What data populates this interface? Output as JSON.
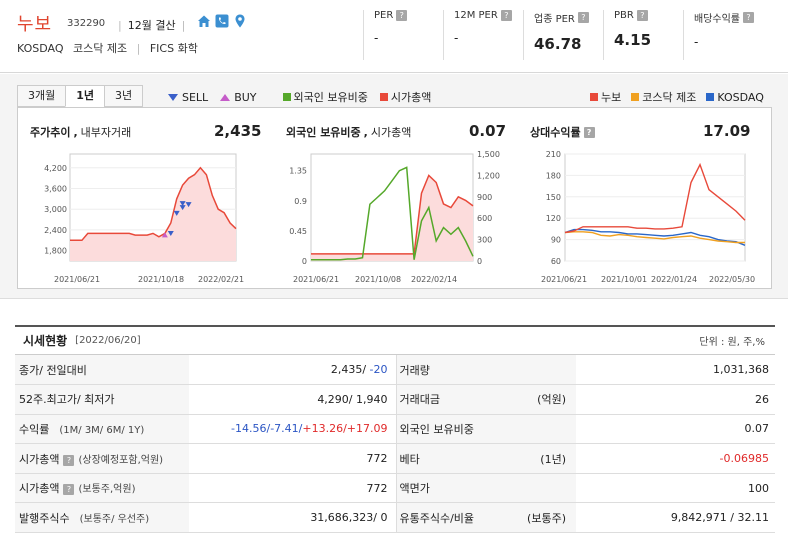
{
  "header": {
    "name": "누보",
    "code": "332290",
    "fiscal": "12월 결산",
    "market": "KOSDAQ",
    "sector1": "코스닥 제조",
    "sector2": "FICS 화학",
    "metrics": [
      {
        "label": "PER",
        "value": "-"
      },
      {
        "label": "12M PER",
        "value": "-"
      },
      {
        "label": "업종 PER",
        "value": "46.78"
      },
      {
        "label": "PBR",
        "value": "4.15"
      },
      {
        "label": "배당수익률",
        "value": "-"
      }
    ]
  },
  "tabs": [
    "3개월",
    "1년",
    "3년"
  ],
  "legend_left": {
    "sell": "SELL",
    "buy": "BUY",
    "foreign": "외국인 보유비중",
    "cap": "시가총액"
  },
  "legend_right": {
    "a": "누보",
    "b": "코스닥 제조",
    "c": "KOSDAQ"
  },
  "colors": {
    "red": "#e8493a",
    "green": "#55a82a",
    "orange": "#f0a020",
    "blue": "#2a67c9",
    "pink": "#fcdcdc"
  },
  "chart_data": [
    {
      "type": "area",
      "title": "주가추이",
      "subtitle": "내부자거래",
      "value": "2,435",
      "x_ticks": [
        "2021/06/21",
        "2021/10/18",
        "2022/02/21"
      ],
      "y_ticks": [
        "4,200",
        "3,600",
        "3,000",
        "2,400",
        "1,800"
      ],
      "ylim": [
        1500,
        4600
      ],
      "series": [
        {
          "values": [
            2100,
            2100,
            2100,
            2300,
            2300,
            2300,
            2300,
            2300,
            2300,
            2300,
            2300,
            2250,
            2250,
            2250,
            2300,
            2200,
            2300,
            2600,
            3300,
            3700,
            3900,
            4000,
            4200,
            4000,
            3400,
            3000,
            2900,
            2600,
            2435
          ]
        }
      ]
    },
    {
      "type": "line",
      "title": "외국인 보유비중",
      "subtitle": "시가총액",
      "value": "0.07",
      "x_ticks": [
        "2021/06/21",
        "2021/10/08",
        "2022/02/14"
      ],
      "y_ticks_left": [
        "1.35",
        "0.9",
        "0.45",
        "0"
      ],
      "y_ticks_right": [
        "1,500",
        "1,200",
        "900",
        "600",
        "300",
        "0"
      ],
      "series": [
        {
          "name": "외국인 보유비중",
          "values": [
            0.02,
            0.02,
            0.02,
            0.02,
            0.02,
            0.03,
            0.03,
            0.05,
            0.85,
            0.95,
            1.05,
            1.2,
            1.35,
            1.4,
            0.02,
            0.6,
            0.8,
            0.3,
            0.5,
            0.4,
            0.5,
            0.3,
            0.07
          ]
        },
        {
          "name": "시가총액",
          "values": [
            100,
            100,
            100,
            100,
            100,
            100,
            100,
            100,
            100,
            100,
            100,
            100,
            100,
            100,
            100,
            950,
            1200,
            1100,
            800,
            750,
            900,
            850,
            772
          ]
        }
      ]
    },
    {
      "type": "line",
      "title": "상대수익률",
      "value": "17.09",
      "x_ticks": [
        "2021/06/21",
        "2021/10/01",
        "2022/01/24",
        "2022/05/30"
      ],
      "y_ticks": [
        "210",
        "180",
        "150",
        "120",
        "90",
        "60"
      ],
      "ylim": [
        60,
        210
      ],
      "series": [
        {
          "name": "누보",
          "values": [
            100,
            102,
            108,
            108,
            108,
            108,
            108,
            108,
            106,
            106,
            105,
            105,
            106,
            108,
            170,
            195,
            160,
            150,
            140,
            130,
            117
          ]
        },
        {
          "name": "코스닥 제조",
          "values": [
            100,
            101,
            101,
            100,
            96,
            95,
            97,
            96,
            94,
            93,
            92,
            91,
            93,
            94,
            95,
            92,
            90,
            88,
            87,
            86,
            86
          ]
        },
        {
          "name": "KOSDAQ",
          "values": [
            100,
            104,
            104,
            103,
            101,
            101,
            100,
            98,
            98,
            97,
            96,
            95,
            96,
            98,
            100,
            96,
            94,
            90,
            88,
            87,
            82
          ]
        }
      ]
    }
  ],
  "table": {
    "title": "시세현황",
    "date": "[2022/06/20]",
    "unit": "단위 : 원, 주,%",
    "rows": [
      {
        "k": "종가/ 전일대비",
        "kd": "",
        "v1": "2,435/ ",
        "v1b": "-20",
        "k2": "거래량",
        "k2d": "",
        "v2": "1,031,368"
      },
      {
        "k": "52주.최고가/ 최저가",
        "kd": "",
        "v1": "4,290/ 1,940",
        "k2": "거래대금",
        "k2d": "(억원)",
        "v2": "26"
      },
      {
        "k": "수익률",
        "kd": "(1M/ 3M/ 6M/ 1Y)",
        "r": [
          "-14.56/",
          "-7.41/",
          "+13.26/",
          "+17.09"
        ],
        "k2": "외국인 보유비중",
        "k2d": "",
        "v2": "0.07"
      },
      {
        "k": "시가총액",
        "kd": "(상장예정포함,억원)",
        "v1": "772",
        "k2": "베타",
        "k2d": "(1년)",
        "v2": "-0.06985"
      },
      {
        "k": "시가총액",
        "kd": "(보통주,억원)",
        "v1": "772",
        "k2": "액면가",
        "k2d": "",
        "v2": "100"
      },
      {
        "k": "발행주식수",
        "kd": "(보통주/ 우선주)",
        "v1": "31,686,323/ 0",
        "k2": "유통주식수/비율",
        "k2d": "(보통주)",
        "v2": "9,842,971 / 32.11"
      }
    ]
  }
}
